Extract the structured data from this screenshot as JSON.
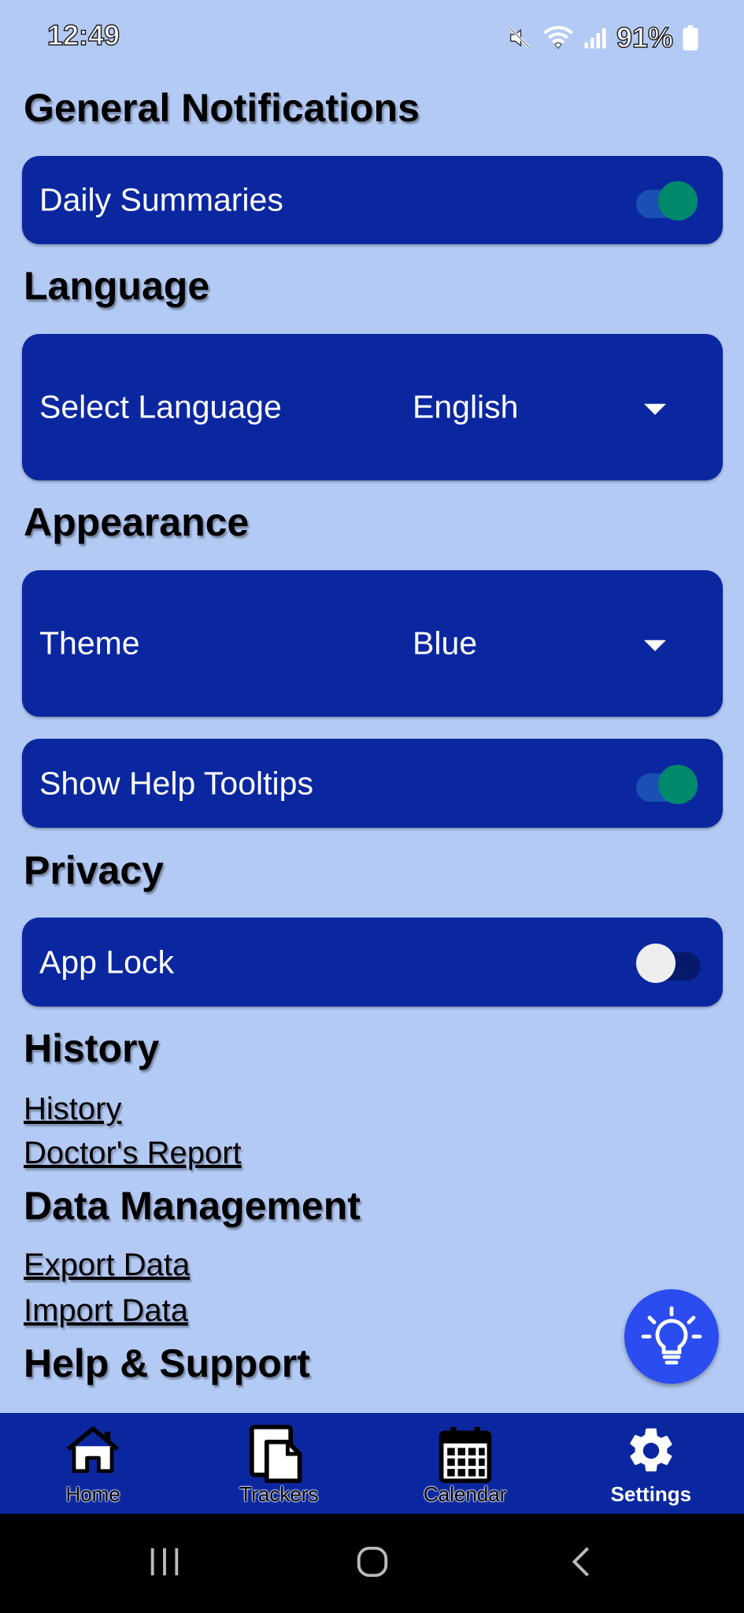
{
  "status_bar": {
    "time": "12:49",
    "battery": "91%",
    "icons": [
      "mute-icon",
      "wifi-icon",
      "signal-icon",
      "battery-icon"
    ]
  },
  "sections": {
    "general_notifications": {
      "heading": "General Notifications",
      "daily_summaries": {
        "label": "Daily Summaries",
        "enabled": true
      }
    },
    "language": {
      "heading": "Language",
      "select_label": "Select Language",
      "selected_value": "English"
    },
    "appearance": {
      "heading": "Appearance",
      "theme_label": "Theme",
      "theme_value": "Blue",
      "help_tooltips": {
        "label": "Show Help Tooltips",
        "enabled": true
      }
    },
    "privacy": {
      "heading": "Privacy",
      "app_lock": {
        "label": "App Lock",
        "enabled": false
      }
    },
    "history": {
      "heading": "History",
      "links": [
        "History",
        "Doctor's Report"
      ]
    },
    "data_management": {
      "heading": "Data Management",
      "links": [
        "Export Data",
        "Import Data"
      ]
    },
    "help_support": {
      "heading": "Help & Support"
    }
  },
  "fab": {
    "icon": "lightbulb-icon"
  },
  "bottom_nav": {
    "items": [
      {
        "label": "Home",
        "icon": "home-icon",
        "active": false
      },
      {
        "label": "Trackers",
        "icon": "trackers-icon",
        "active": false
      },
      {
        "label": "Calendar",
        "icon": "calendar-icon",
        "active": false
      },
      {
        "label": "Settings",
        "icon": "gear-icon",
        "active": true
      }
    ]
  },
  "colors": {
    "background": "#b3caf5",
    "card": "#0b27a0",
    "toggle_on": "#00896b",
    "fab": "#2a4cf0"
  }
}
